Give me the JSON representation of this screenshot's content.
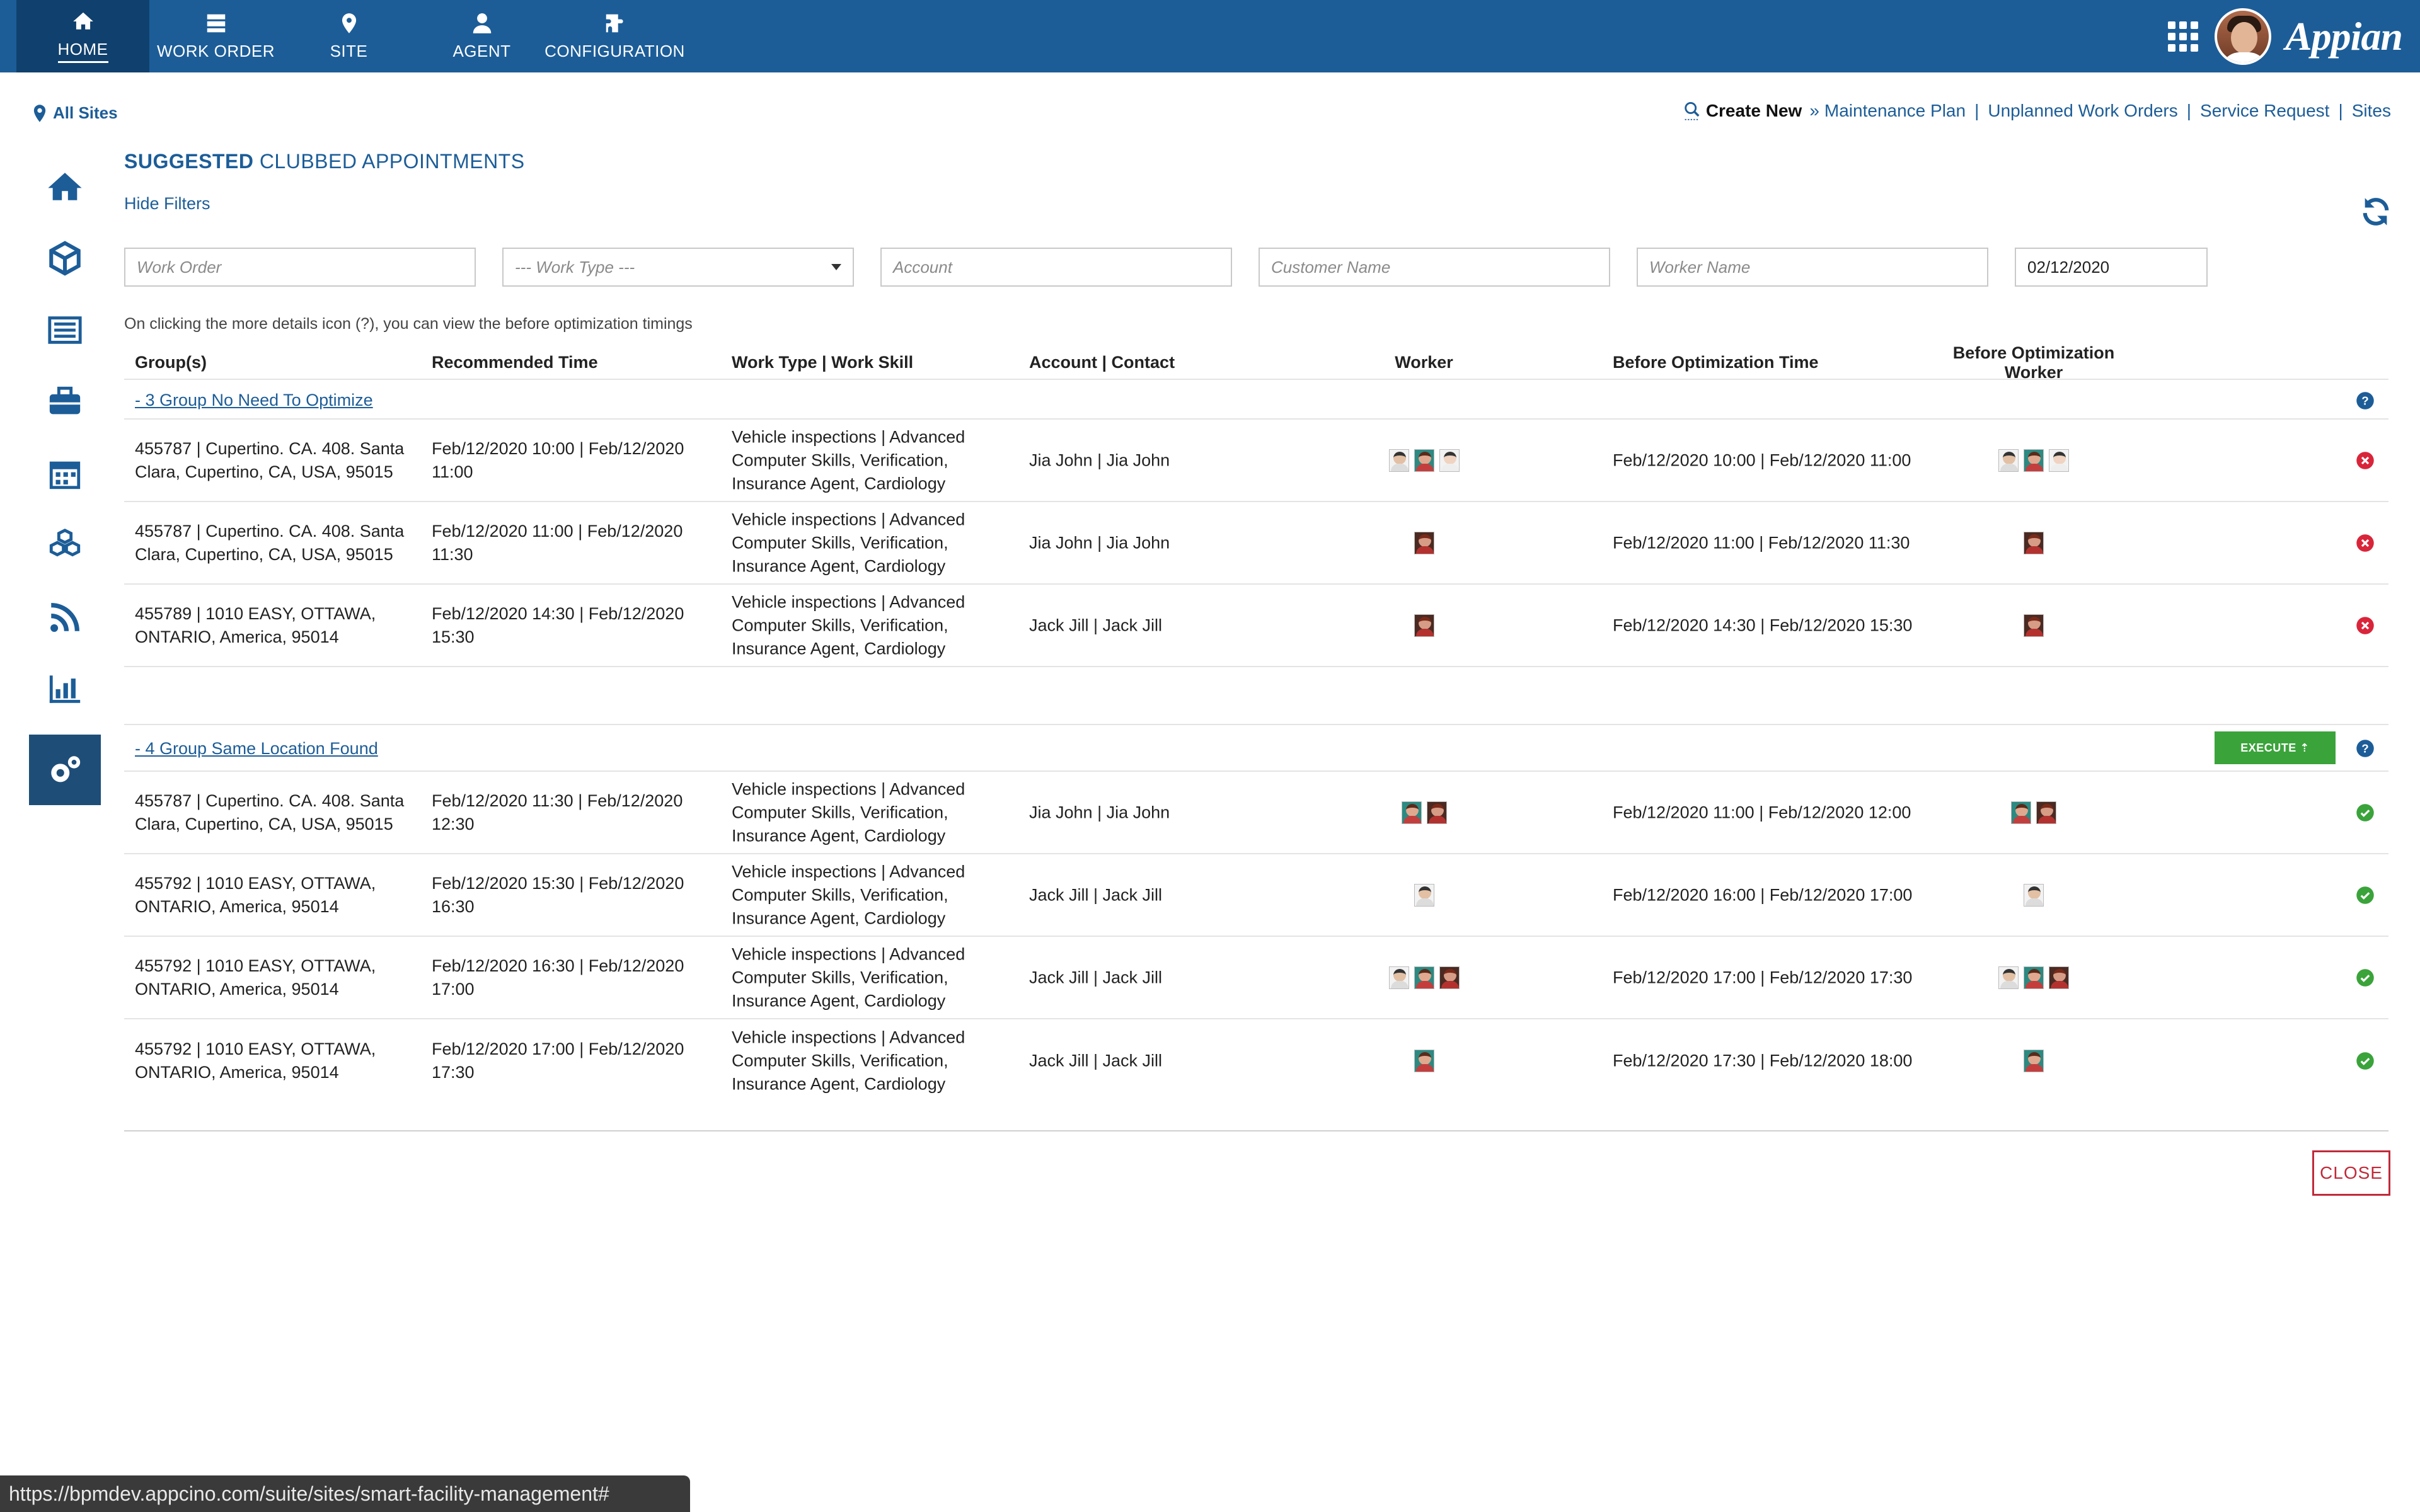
{
  "nav": {
    "items": [
      {
        "label": "HOME",
        "icon": "home-icon"
      },
      {
        "label": "WORK ORDER",
        "icon": "work-order-icon"
      },
      {
        "label": "SITE",
        "icon": "map-pin-icon"
      },
      {
        "label": "AGENT",
        "icon": "user-icon"
      },
      {
        "label": "CONFIGURATION",
        "icon": "puzzle-icon"
      }
    ],
    "brand": "Appian"
  },
  "location": {
    "label": "All Sites"
  },
  "create_new": {
    "label": "Create New",
    "links": [
      "Maintenance Plan",
      "Unplanned Work Orders",
      "Service Request",
      "Sites"
    ]
  },
  "title": {
    "bold": "SUGGESTED",
    "rest": " CLUBBED APPOINTMENTS"
  },
  "hide_filters": "Hide Filters",
  "filters": {
    "work_order": "Work Order",
    "work_type": "--- Work Type ---",
    "account": "Account",
    "customer_name": "Customer Name",
    "worker_name": "Worker Name",
    "date": "02/12/2020"
  },
  "note": "On clicking the more details icon (?), you can view the before optimization timings",
  "columns": [
    "Group(s)",
    "Recommended Time",
    "Work Type | Work Skill",
    "Account | Contact",
    "Worker",
    "Before Optimization Time",
    "Before Optimization Worker"
  ],
  "groups": [
    {
      "label": "- 3 Group No Need To Optimize",
      "rows": [
        {
          "group": "455787 | Cupertino. CA. 408. Santa Clara, Cupertino, CA, USA, 95015",
          "time": "Feb/12/2020 10:00 | Feb/12/2020 11:00",
          "work": "Vehicle inspections | Advanced Computer Skills, Verification, Insurance Agent, Cardiology",
          "account": "Jia John | Jia John",
          "before_time": "Feb/12/2020 10:00 | Feb/12/2020 11:00"
        },
        {
          "group": "455787 | Cupertino. CA. 408. Santa Clara, Cupertino, CA, USA, 95015",
          "time": "Feb/12/2020 11:00 | Feb/12/2020 11:30",
          "work": "Vehicle inspections | Advanced Computer Skills, Verification, Insurance Agent, Cardiology",
          "account": "Jia John | Jia John",
          "before_time": "Feb/12/2020 11:00 | Feb/12/2020 11:30"
        },
        {
          "group": "455789 | 1010 EASY, OTTAWA, ONTARIO, America, 95014",
          "time": "Feb/12/2020 14:30 | Feb/12/2020 15:30",
          "work": "Vehicle inspections | Advanced Computer Skills, Verification, Insurance Agent, Cardiology",
          "account": "Jack Jill | Jack Jill",
          "before_time": "Feb/12/2020 14:30 | Feb/12/2020 15:30"
        }
      ]
    },
    {
      "label": "- 4 Group Same Location Found",
      "execute_label": "EXECUTE ⇡",
      "rows": [
        {
          "group": "455787 | Cupertino. CA. 408. Santa Clara, Cupertino, CA, USA, 95015",
          "time": "Feb/12/2020 11:30 | Feb/12/2020 12:30",
          "work": "Vehicle inspections | Advanced Computer Skills, Verification, Insurance Agent, Cardiology",
          "account": "Jia John | Jia John",
          "before_time": "Feb/12/2020 11:00 | Feb/12/2020 12:00"
        },
        {
          "group": "455792 | 1010 EASY, OTTAWA, ONTARIO, America, 95014",
          "time": "Feb/12/2020 15:30 | Feb/12/2020 16:30",
          "work": "Vehicle inspections | Advanced Computer Skills, Verification, Insurance Agent, Cardiology",
          "account": "Jack Jill | Jack Jill",
          "before_time": "Feb/12/2020 16:00 | Feb/12/2020 17:00"
        },
        {
          "group": "455792 | 1010 EASY, OTTAWA, ONTARIO, America, 95014",
          "time": "Feb/12/2020 16:30 | Feb/12/2020 17:00",
          "work": "Vehicle inspections | Advanced Computer Skills, Verification, Insurance Agent, Cardiology",
          "account": "Jack Jill | Jack Jill",
          "before_time": "Feb/12/2020 17:00 | Feb/12/2020 17:30"
        },
        {
          "group": "455792 | 1010 EASY, OTTAWA, ONTARIO, America, 95014",
          "time": "Feb/12/2020 17:00 | Feb/12/2020 17:30",
          "work": "Vehicle inspections | Advanced Computer Skills, Verification, Insurance Agent, Cardiology",
          "account": "Jack Jill | Jack Jill",
          "before_time": "Feb/12/2020 17:30 | Feb/12/2020 18:00"
        }
      ]
    }
  ],
  "close_label": "CLOSE",
  "status_url": "https://bpmdev.appcino.com/suite/sites/smart-facility-management#",
  "colors": {
    "primary": "#1c5d98",
    "nav_active": "#10406d",
    "success": "#3aa33a",
    "error": "#d9253a"
  }
}
